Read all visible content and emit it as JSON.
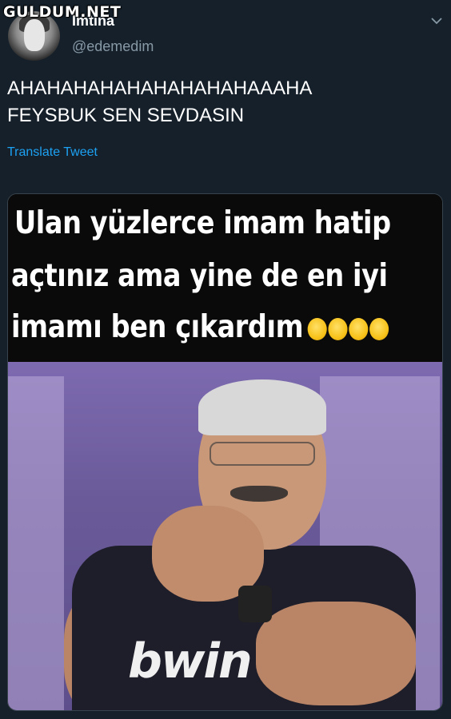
{
  "watermark": {
    "text": "GULDUM.NET"
  },
  "author": {
    "display_name": "İmtina",
    "handle": "@edemedim"
  },
  "tweet": {
    "text_line1": "AHAHAHAHAHAHAHAHAHAAAHA",
    "text_line2": "FEYSBUK SEN SEVDASIN",
    "translate_label": "Translate Tweet"
  },
  "media": {
    "caption_line1": "Ulan yüzlerce imam hatip",
    "caption_line2": "açtınız ama yine de en iyi",
    "caption_line3": "imamı ben çıkardım",
    "caption_emoji_count": 4,
    "shirt_text": "bwin"
  },
  "colors": {
    "background": "#15202b",
    "link": "#1da1f2",
    "secondary_text": "#8899a6"
  },
  "icons": {
    "menu": "chevron-down-icon"
  }
}
